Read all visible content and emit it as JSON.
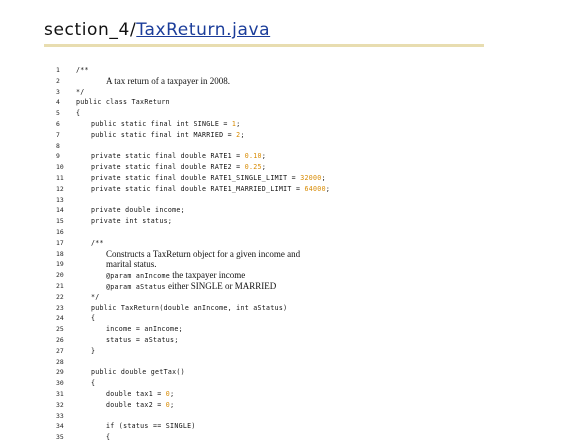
{
  "header": {
    "prefix": "section_4/",
    "link": "TaxReturn.java"
  },
  "code": [
    {
      "n": "1",
      "indent": 0,
      "parts": [
        {
          "t": "/**"
        }
      ]
    },
    {
      "n": "2",
      "indent": 2,
      "doc": true,
      "parts": [
        {
          "t": "A tax return of a taxpayer in 2008."
        }
      ]
    },
    {
      "n": "3",
      "indent": 0,
      "parts": [
        {
          "t": "*/"
        }
      ]
    },
    {
      "n": "4",
      "indent": 0,
      "parts": [
        {
          "t": "public class TaxReturn"
        }
      ]
    },
    {
      "n": "5",
      "indent": 0,
      "parts": [
        {
          "t": "{"
        }
      ]
    },
    {
      "n": "6",
      "indent": 1,
      "parts": [
        {
          "t": "public static final int SINGLE = "
        },
        {
          "t": "1",
          "c": "num"
        },
        {
          "t": ";"
        }
      ]
    },
    {
      "n": "7",
      "indent": 1,
      "parts": [
        {
          "t": "public static final int MARRIED = "
        },
        {
          "t": "2",
          "c": "num"
        },
        {
          "t": ";"
        }
      ]
    },
    {
      "n": "8",
      "indent": 0,
      "parts": [
        {
          "t": ""
        }
      ]
    },
    {
      "n": "9",
      "indent": 1,
      "parts": [
        {
          "t": "private static final double RATE1 = "
        },
        {
          "t": "0.10",
          "c": "num"
        },
        {
          "t": ";"
        }
      ]
    },
    {
      "n": "10",
      "indent": 1,
      "parts": [
        {
          "t": "private static final double RATE2 = "
        },
        {
          "t": "0.25",
          "c": "num"
        },
        {
          "t": ";"
        }
      ]
    },
    {
      "n": "11",
      "indent": 1,
      "parts": [
        {
          "t": "private static final double RATE1_SINGLE_LIMIT = "
        },
        {
          "t": "32000",
          "c": "num"
        },
        {
          "t": ";"
        }
      ]
    },
    {
      "n": "12",
      "indent": 1,
      "parts": [
        {
          "t": "private static final double RATE1_MARRIED_LIMIT = "
        },
        {
          "t": "64000",
          "c": "num"
        },
        {
          "t": ";"
        }
      ]
    },
    {
      "n": "13",
      "indent": 0,
      "parts": [
        {
          "t": ""
        }
      ]
    },
    {
      "n": "14",
      "indent": 1,
      "parts": [
        {
          "t": "private double income;"
        }
      ]
    },
    {
      "n": "15",
      "indent": 1,
      "parts": [
        {
          "t": "private int status;"
        }
      ]
    },
    {
      "n": "16",
      "indent": 0,
      "parts": [
        {
          "t": ""
        }
      ]
    },
    {
      "n": "17",
      "indent": 1,
      "parts": [
        {
          "t": "/**"
        }
      ]
    },
    {
      "n": "18",
      "indent": 2,
      "doc": true,
      "parts": [
        {
          "t": "Constructs a TaxReturn object for a given income and"
        }
      ]
    },
    {
      "n": "19",
      "indent": 2,
      "doc": true,
      "parts": [
        {
          "t": "marital status."
        }
      ]
    },
    {
      "n": "20",
      "indent": 2,
      "parts": [
        {
          "t": "@param anIncome"
        },
        {
          "t": " the taxpayer income",
          "c": "docinline"
        }
      ]
    },
    {
      "n": "21",
      "indent": 2,
      "parts": [
        {
          "t": "@param aStatus"
        },
        {
          "t": " either SINGLE or MARRIED",
          "c": "docinline"
        }
      ]
    },
    {
      "n": "22",
      "indent": 1,
      "parts": [
        {
          "t": "*/"
        }
      ]
    },
    {
      "n": "23",
      "indent": 1,
      "parts": [
        {
          "t": "public TaxReturn(double anIncome, int aStatus)"
        }
      ]
    },
    {
      "n": "24",
      "indent": 1,
      "parts": [
        {
          "t": "{"
        }
      ]
    },
    {
      "n": "25",
      "indent": 2,
      "parts": [
        {
          "t": "income = anIncome;"
        }
      ]
    },
    {
      "n": "26",
      "indent": 2,
      "parts": [
        {
          "t": "status = aStatus;"
        }
      ]
    },
    {
      "n": "27",
      "indent": 1,
      "parts": [
        {
          "t": "}"
        }
      ]
    },
    {
      "n": "28",
      "indent": 0,
      "parts": [
        {
          "t": ""
        }
      ]
    },
    {
      "n": "29",
      "indent": 1,
      "parts": [
        {
          "t": "public double getTax()"
        }
      ]
    },
    {
      "n": "30",
      "indent": 1,
      "parts": [
        {
          "t": "{"
        }
      ]
    },
    {
      "n": "31",
      "indent": 2,
      "parts": [
        {
          "t": "double tax1 = "
        },
        {
          "t": "0",
          "c": "num"
        },
        {
          "t": ";"
        }
      ]
    },
    {
      "n": "32",
      "indent": 2,
      "parts": [
        {
          "t": "double tax2 = "
        },
        {
          "t": "0",
          "c": "num"
        },
        {
          "t": ";"
        }
      ]
    },
    {
      "n": "33",
      "indent": 0,
      "parts": [
        {
          "t": ""
        }
      ]
    },
    {
      "n": "34",
      "indent": 2,
      "parts": [
        {
          "t": "if (status == SINGLE)"
        }
      ]
    },
    {
      "n": "35",
      "indent": 2,
      "parts": [
        {
          "t": "{"
        }
      ]
    }
  ]
}
